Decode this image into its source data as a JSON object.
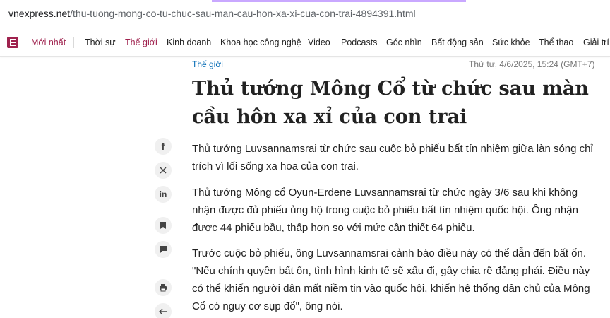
{
  "browser": {
    "url_domain": "vnexpress.net",
    "url_path": "/thu-tuong-mong-co-tu-chuc-sau-man-cau-hon-xa-xi-cua-con-trai-4894391.html"
  },
  "nav": {
    "latest": "Mới nhất",
    "items": [
      "Thời sự",
      "Thế giới",
      "Kinh doanh",
      "Khoa học công nghệ",
      "Video",
      "Podcasts",
      "Góc nhìn",
      "Bất động sản",
      "Sức khỏe",
      "Thể thao",
      "Giải trí"
    ],
    "active_index": 1,
    "accent_color": "#9f224e"
  },
  "article": {
    "category": "Thế giới",
    "date": "Thứ tư, 4/6/2025, 15:24 (GMT+7)",
    "title": "Thủ tướng Mông Cổ từ chức sau màn cầu hôn xa xỉ của con trai",
    "paragraphs": [
      "Thủ tướng Luvsannamsrai từ chức sau cuộc bỏ phiếu bất tín nhiệm giữa làn sóng chỉ trích vì lối sống xa hoa của con trai.",
      "Thủ tướng Mông cổ Oyun-Erdene Luvsannamsrai từ chức ngày 3/6 sau khi không nhận được đủ phiếu ủng hộ trong cuộc bỏ phiếu bất tín nhiệm quốc hội. Ông nhận được 44 phiếu bầu, thấp hơn so với mức cần thiết 64 phiếu.",
      "Trước cuộc bỏ phiếu, ông Luvsannamsrai cảnh báo điều này có thể dẫn đến bất ổn. \"Nếu chính quyền bất ổn, tình hình kinh tế sẽ xấu đi, gây chia rẽ đảng phái. Điều này có thể khiến người dân mất niềm tin vào quốc hội, khiến hệ thống dân chủ của Mông Cổ có nguy cơ sụp đổ\", ông nói."
    ]
  },
  "social": {
    "facebook_glyph": "f",
    "linkedin_glyph": "in",
    "icons": [
      "facebook-icon",
      "x-icon",
      "linkedin-icon",
      "bookmark-icon",
      "comment-icon",
      "print-icon",
      "back-icon"
    ]
  }
}
